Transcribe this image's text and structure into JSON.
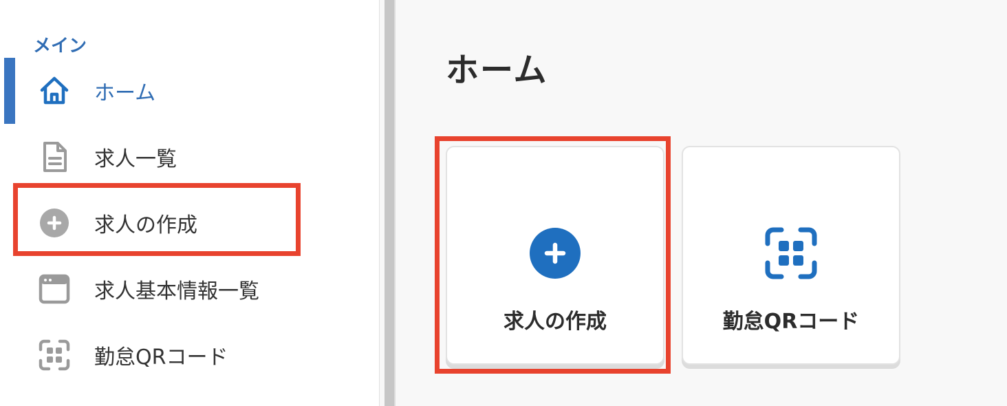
{
  "sidebar": {
    "section_label": "メイン",
    "items": [
      {
        "label": "ホーム",
        "icon": "home-icon",
        "active": true
      },
      {
        "label": "求人一覧",
        "icon": "document-icon"
      },
      {
        "label": "求人の作成",
        "icon": "plus-circle-icon"
      },
      {
        "label": "求人基本情報一覧",
        "icon": "window-icon"
      },
      {
        "label": "勤怠QRコード",
        "icon": "qr-scan-icon"
      }
    ]
  },
  "main": {
    "title": "ホーム",
    "cards": [
      {
        "label": "求人の作成",
        "icon": "plus-circle-icon"
      },
      {
        "label": "勤怠QRコード",
        "icon": "qr-scan-icon"
      }
    ]
  },
  "colors": {
    "accent": "#2f6cb3",
    "active_bar": "#3a75c0",
    "icon_blue": "#1f6fbf",
    "icon_gray": "#9a9a9a",
    "highlight": "#e8432e"
  }
}
